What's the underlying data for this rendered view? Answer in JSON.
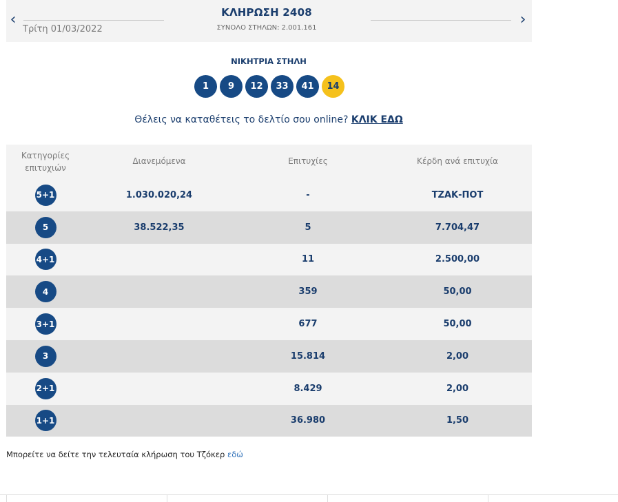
{
  "header": {
    "title": "ΚΛΗΡΩΣΗ 2408",
    "total_columns": "ΣΥΝΟΛΟ ΣΤΗΛΩΝ: 2.001.161",
    "date": "Τρίτη 01/03/2022",
    "prev_icon": "‹",
    "next_icon": "›"
  },
  "winning": {
    "label": "ΝΙΚΗΤΡΙΑ ΣΤΗΛΗ",
    "numbers": [
      "1",
      "9",
      "12",
      "33",
      "41"
    ],
    "joker": "14"
  },
  "promo": {
    "text": "Θέλεις να καταθέτεις το δελτίο σου online?",
    "link": "ΚΛΙΚ ΕΔΩ"
  },
  "table": {
    "headers": {
      "category_line1": "Κατηγορίες",
      "category_line2": "επιτυχιών",
      "distributed": "Διανεμόμενα",
      "winners": "Επιτυχίες",
      "prize": "Κέρδη ανά επιτυχία"
    },
    "rows": [
      {
        "category": "5+1",
        "distributed": "1.030.020,24",
        "winners": "-",
        "prize": "ΤΖΑΚ-ΠΟΤ"
      },
      {
        "category": "5",
        "distributed": "38.522,35",
        "winners": "5",
        "prize": "7.704,47"
      },
      {
        "category": "4+1",
        "distributed": "",
        "winners": "11",
        "prize": "2.500,00"
      },
      {
        "category": "4",
        "distributed": "",
        "winners": "359",
        "prize": "50,00"
      },
      {
        "category": "3+1",
        "distributed": "",
        "winners": "677",
        "prize": "50,00"
      },
      {
        "category": "3",
        "distributed": "",
        "winners": "15.814",
        "prize": "2,00"
      },
      {
        "category": "2+1",
        "distributed": "",
        "winners": "8.429",
        "prize": "2,00"
      },
      {
        "category": "1+1",
        "distributed": "",
        "winners": "36.980",
        "prize": "1,50"
      }
    ]
  },
  "footer": {
    "text": "Μπορείτε να δείτε την τελευταία κλήρωση του Τζόκερ",
    "link": "εδώ"
  },
  "colors": {
    "brand_blue": "#174a85",
    "joker_yellow": "#f5c11c",
    "row_light": "#f3f3f3",
    "row_dark": "#dcdcdc"
  }
}
